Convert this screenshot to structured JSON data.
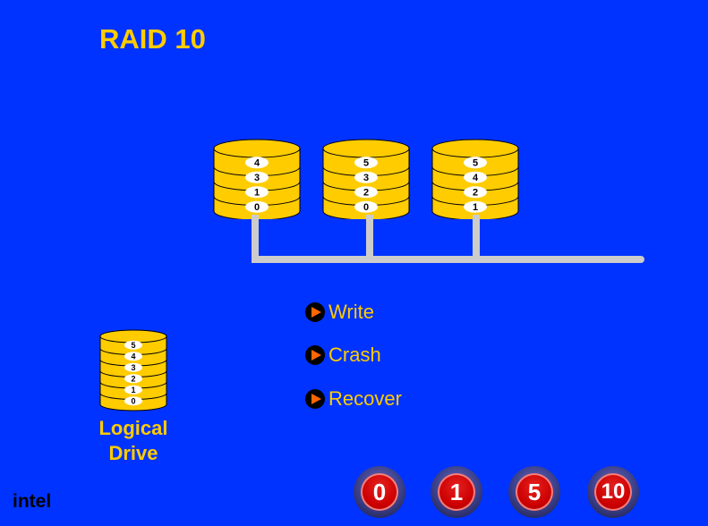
{
  "title": "RAID 10",
  "colors": {
    "background": "#0033ff",
    "accent": "#ffcc00",
    "disk_fill": "#ffcc00",
    "bus": "#cccccc",
    "button_red": "#cc0000",
    "bullet_arrow": "#ff6600"
  },
  "physical_disks": [
    {
      "blocks": [
        "4",
        "3",
        "1",
        "0"
      ]
    },
    {
      "blocks": [
        "5",
        "3",
        "2",
        "0"
      ]
    },
    {
      "blocks": [
        "5",
        "4",
        "2",
        "1"
      ]
    }
  ],
  "logical_drive": {
    "label_line1": "Logical",
    "label_line2": "Drive",
    "blocks": [
      "5",
      "4",
      "3",
      "2",
      "1",
      "0"
    ]
  },
  "menu": [
    {
      "label": "Write",
      "icon": "play-bullet-icon"
    },
    {
      "label": "Crash",
      "icon": "play-bullet-icon"
    },
    {
      "label": "Recover",
      "icon": "play-bullet-icon"
    }
  ],
  "raid_buttons": [
    {
      "label": "0"
    },
    {
      "label": "1"
    },
    {
      "label": "5"
    },
    {
      "label": "10"
    }
  ],
  "logo": "intel"
}
